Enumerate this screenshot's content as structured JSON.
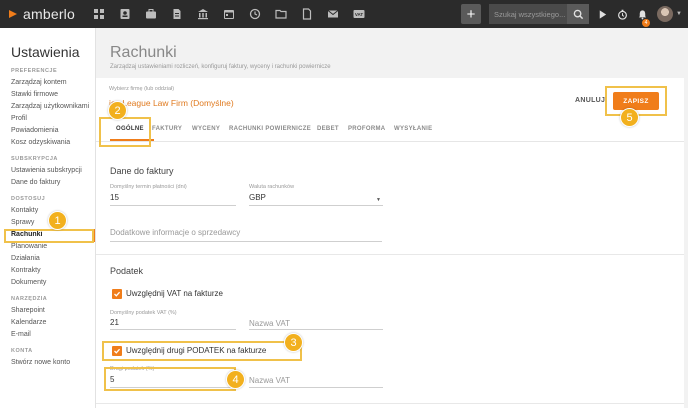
{
  "topbar": {
    "logo_text": "amberlo",
    "search_placeholder": "Szukaj wszystkiego...",
    "bell_count": "4",
    "nav_icons": [
      "dashboard-icon",
      "contacts-icon",
      "briefcase-icon",
      "document-icon",
      "bank-icon",
      "calendar-icon",
      "history-icon",
      "folder-icon",
      "file-icon",
      "mail-icon",
      "vat-icon"
    ],
    "vat_label": "VAT"
  },
  "sidebar": {
    "title": "Ustawienia",
    "sections": [
      {
        "heading": "PREFERENCJE",
        "items": [
          "Zarządzaj kontem",
          "Stawki firmowe",
          "Zarządzaj użytkownikami",
          "Profil",
          "Powiadomienia",
          "Kosz odzyskiwania"
        ]
      },
      {
        "heading": "SUBSKRYPCJA",
        "items": [
          "Ustawienia subskrypcji",
          "Dane do faktury"
        ]
      },
      {
        "heading": "DOSTOSUJ",
        "items": [
          "Kontakty",
          "Sprawy",
          "Rachunki",
          "Planowanie",
          "Działania",
          "Kontrakty",
          "Dokumenty"
        ]
      },
      {
        "heading": "NARZĘDZIA",
        "items": [
          "Sharepoint",
          "Kalendarze",
          "E-mail"
        ]
      },
      {
        "heading": "KONTA",
        "items": [
          "Stwórz nowe konto"
        ]
      }
    ],
    "active_item": "Rachunki"
  },
  "page": {
    "title": "Rachunki",
    "subtitle": "Zarządzaj ustawieniami rozliczeń, konfiguruj faktury, wyceny i rachunki powiernicze",
    "firm_label": "Wybierz firmę (lub oddział)",
    "firm_value": "ice League Law Firm (Domyślne)",
    "cancel_label": "ANULUJ",
    "save_label": "ZAPISZ",
    "tabs": [
      "OGÓLNE",
      "FAKTURY",
      "WYCENY",
      "RACHUNKI POWIERNICZE",
      "DEBET",
      "PROFORMA",
      "WYSYŁANIE"
    ],
    "active_tab": "OGÓLNE"
  },
  "invoice_data": {
    "title": "Dane do faktury",
    "payment_term_label": "Domyślny termin płatności (dni)",
    "payment_term_value": "15",
    "currency_label": "Waluta rachunków",
    "currency_value": "GBP",
    "extra_info_placeholder": "Dodatkowe informacje o sprzedawcy"
  },
  "tax": {
    "title": "Podatek",
    "include_vat_label": "Uwzględnij VAT na fakturze",
    "include_vat_checked": true,
    "default_vat_label": "Domyślny podatek VAT (%)",
    "default_vat_value": "21",
    "vat_name_placeholder": "Nazwa VAT",
    "include_second_label": "Uwzględnij drugi PODATEK na fakturze",
    "include_second_checked": true,
    "second_tax_label": "Drugi podatek (%)",
    "second_tax_value": "5",
    "second_vat_name_placeholder": "Nazwa VAT"
  },
  "tutorial_steps": [
    "1",
    "2",
    "3",
    "4",
    "5"
  ],
  "colors": {
    "accent": "#f07d1a",
    "highlight": "#f0c14a",
    "badge": "#f2b01e",
    "topbar": "#2b2b2b"
  }
}
